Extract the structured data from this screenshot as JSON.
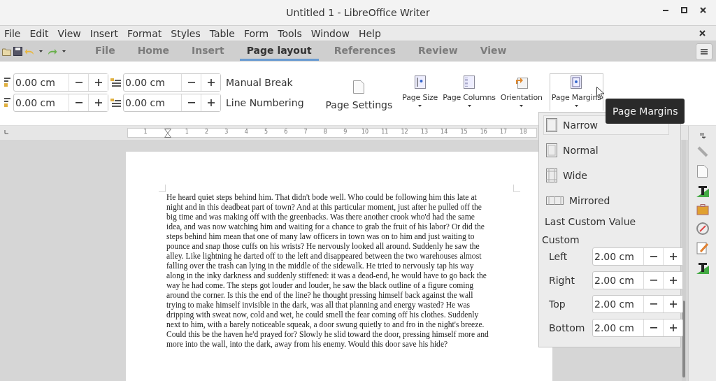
{
  "window": {
    "title": "Untitled 1 - LibreOffice Writer"
  },
  "menu_bar": {
    "items": [
      "File",
      "Edit",
      "View",
      "Insert",
      "Format",
      "Styles",
      "Table",
      "Form",
      "Tools",
      "Window",
      "Help"
    ]
  },
  "tabs": [
    {
      "label": "File",
      "selected": false
    },
    {
      "label": "Home",
      "selected": false
    },
    {
      "label": "Insert",
      "selected": false
    },
    {
      "label": "Page layout",
      "selected": true
    },
    {
      "label": "References",
      "selected": false
    },
    {
      "label": "Review",
      "selected": false
    },
    {
      "label": "View",
      "selected": false
    }
  ],
  "ribbon": {
    "spin_fields": [
      {
        "value": "0.00 cm"
      },
      {
        "value": "0.00 cm"
      },
      {
        "value": "0.00 cm"
      },
      {
        "value": "0.00 cm"
      }
    ],
    "toggles": [
      "Manual Break",
      "Line Numbering"
    ],
    "buttons": [
      {
        "label": "Page Settings",
        "kind": "large",
        "expanded": false
      },
      {
        "label": "Page Size",
        "kind": "dropdown",
        "expanded": false
      },
      {
        "label": "Page Columns",
        "kind": "dropdown",
        "expanded": false
      },
      {
        "label": "Orientation",
        "kind": "dropdown",
        "expanded": false
      },
      {
        "label": "Page Margins",
        "kind": "dropdown",
        "expanded": true
      }
    ]
  },
  "ruler": {
    "labels": [
      "1",
      "1",
      "2",
      "3",
      "4",
      "5",
      "6",
      "7",
      "8",
      "9",
      "10",
      "11",
      "12",
      "13",
      "14",
      "15",
      "16",
      "17",
      "18"
    ]
  },
  "document": {
    "lines": [
      "He heard quiet steps behind him. That didn't bode well. Who could be following him this late at",
      "night and in this deadbeat part of town? And at this particular moment, just after he pulled off the",
      "big time and was making off with the greenbacks. Was there another crook who'd had the same",
      "idea, and was now watching him and waiting for a chance to grab the fruit of his labor? Or did the",
      "steps behind him mean that one of many law officers in town was on to him and just waiting to",
      "pounce and snap those cuffs on his wrists? He nervously looked all around. Suddenly he saw the",
      "alley. Like lightning he darted off to the left and disappeared between the two warehouses almost",
      "falling over the trash can lying in the middle of the sidewalk. He tried to nervously tap his way",
      "along in the inky darkness and suddenly stiffened: it was a dead-end, he would have to go back the",
      "way he had come. The steps got louder and louder, he saw the black outline of a figure coming",
      "around the corner. Is this the end of the line? he thought pressing himself back against the wall",
      "trying to make himself invisible in the dark, was all that planning and energy wasted? He was",
      "dripping with sweat now, cold and wet, he could smell the fear coming off his clothes. Suddenly",
      "next to him, with a barely noticeable squeak, a door swung quietly to and fro in the night's breeze.",
      "Could this be the haven he'd prayed for? Slowly he slid toward the door, pressing himself more and",
      "more into the wall, into the dark, away from his enemy. Would this door save his hide?"
    ]
  },
  "margins_menu": {
    "presets": [
      {
        "label": "Narrow",
        "kind": "narrow",
        "selected": true
      },
      {
        "label": "Normal",
        "kind": "normal",
        "selected": false
      },
      {
        "label": "Wide",
        "kind": "wide",
        "selected": false
      },
      {
        "label": "Mirrored",
        "kind": "mirrored",
        "selected": false
      }
    ],
    "last_custom": "Last Custom Value",
    "custom_heading": "Custom",
    "fields": [
      {
        "label": "Left",
        "value": "2.00 cm"
      },
      {
        "label": "Right",
        "value": "2.00 cm"
      },
      {
        "label": "Top",
        "value": "2.00 cm"
      },
      {
        "label": "Bottom",
        "value": "2.00 cm"
      }
    ]
  },
  "tooltip": {
    "text": "Page Margins"
  }
}
